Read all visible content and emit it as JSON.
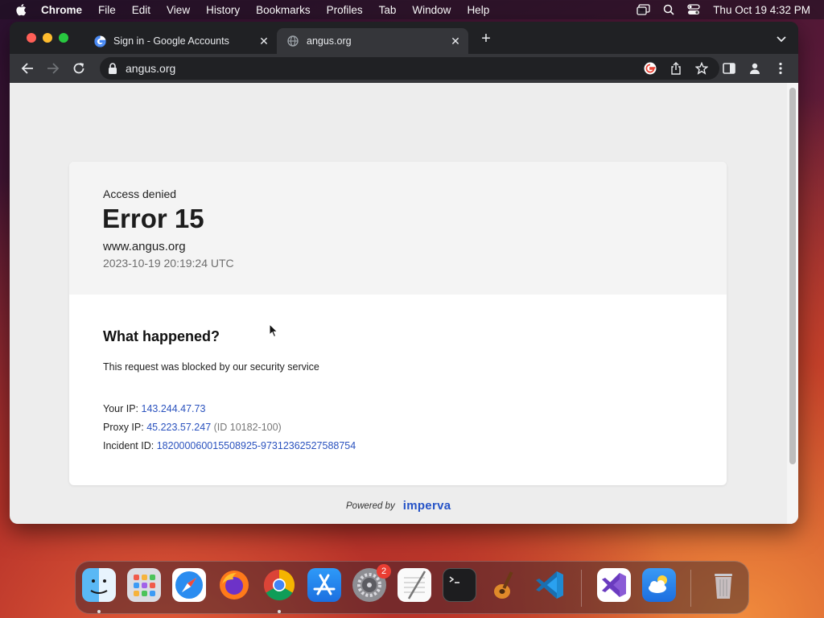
{
  "menubar": {
    "app_name": "Chrome",
    "items": [
      "File",
      "Edit",
      "View",
      "History",
      "Bookmarks",
      "Profiles",
      "Tab",
      "Window",
      "Help"
    ],
    "clock": "Thu Oct 19  4:32 PM"
  },
  "tabs": [
    {
      "title": "Sign in - Google Accounts",
      "favicon": "google-icon",
      "active": false
    },
    {
      "title": "angus.org",
      "favicon": "globe-icon",
      "active": true
    }
  ],
  "toolbar": {
    "url": "angus.org"
  },
  "page": {
    "access_denied": "Access denied",
    "error_code": "Error 15",
    "site": "www.angus.org",
    "timestamp": "2023-10-19 20:19:24 UTC",
    "what_heading": "What happened?",
    "what_desc": "This request was blocked by our security service",
    "your_ip_label": "Your IP:",
    "your_ip": "143.244.47.73",
    "proxy_ip_label": "Proxy IP:",
    "proxy_ip": "45.223.57.247",
    "proxy_id": "(ID 10182-100)",
    "incident_label": "Incident ID:",
    "incident_id": "182000060015508925-97312362527588754",
    "powered_by": "Powered by",
    "brand": "imperva"
  },
  "dock": {
    "items": [
      "finder-icon",
      "launchpad-icon",
      "safari-icon",
      "firefox-icon",
      "chrome-icon",
      "app-store-icon",
      "system-settings-icon",
      "textedit-icon",
      "terminal-icon",
      "garageband-icon",
      "vscode-icon",
      "visual-studio-icon",
      "weather-icon",
      "trash-icon"
    ],
    "settings_badge": "2"
  },
  "colors": {
    "link": "#2a52be",
    "brand": "#2653c7",
    "tab_active": "#35363a",
    "chrome_frame": "#202124"
  }
}
